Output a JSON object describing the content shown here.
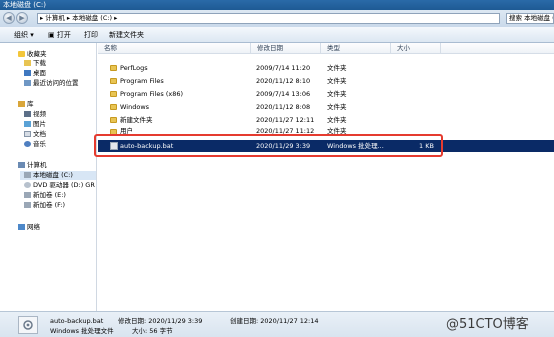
{
  "window": {
    "title": "本地磁盘 (C:)"
  },
  "address": {
    "path": "▸ 计算机 ▸ 本地磁盘 (C:) ▸",
    "search_placeholder": "搜索 本地磁盘 (C:)"
  },
  "toolbar": {
    "organize": "组织 ▾",
    "open": "打开",
    "print": "打印",
    "new_folder": "新建文件夹"
  },
  "navpane": {
    "favorites": "收藏夹",
    "fav_items": [
      "下载",
      "桌面",
      "最近访问的位置"
    ],
    "library": "库",
    "lib_items": [
      "视频",
      "图片",
      "文档",
      "音乐"
    ],
    "computer": "计算机",
    "comp_items": [
      "本地磁盘 (C:)",
      "DVD 驱动器 (D:) GR",
      "新加卷 (E:)",
      "新加卷 (F:)"
    ],
    "network": "网络"
  },
  "columns": {
    "name": "名称",
    "date": "修改日期",
    "type": "类型",
    "size": "大小"
  },
  "files": [
    {
      "name": "PerfLogs",
      "date": "2009/7/14 11:20",
      "type": "文件夹",
      "size": ""
    },
    {
      "name": "Program Files",
      "date": "2020/11/12 8:10",
      "type": "文件夹",
      "size": ""
    },
    {
      "name": "Program Files (x86)",
      "date": "2009/7/14 13:06",
      "type": "文件夹",
      "size": ""
    },
    {
      "name": "Windows",
      "date": "2020/11/12 8:08",
      "type": "文件夹",
      "size": ""
    },
    {
      "name": "新建文件夹",
      "date": "2020/11/27 12:11",
      "type": "文件夹",
      "size": ""
    },
    {
      "name": "用户",
      "date": "2020/11/27 11:12",
      "type": "文件夹",
      "size": ""
    }
  ],
  "selected_file": {
    "name": "auto-backup.bat",
    "date": "2020/11/29 3:39",
    "type": "Windows 批处理...",
    "size": "1 KB"
  },
  "status": {
    "filename": "auto-backup.bat",
    "modified_label": "修改日期: 2020/11/29 3:39",
    "created_label": "创建日期: 2020/11/27 12:14",
    "type": "Windows 批处理文件",
    "size_label": "大小: 56 字节"
  },
  "watermark": "@51CTO博客"
}
